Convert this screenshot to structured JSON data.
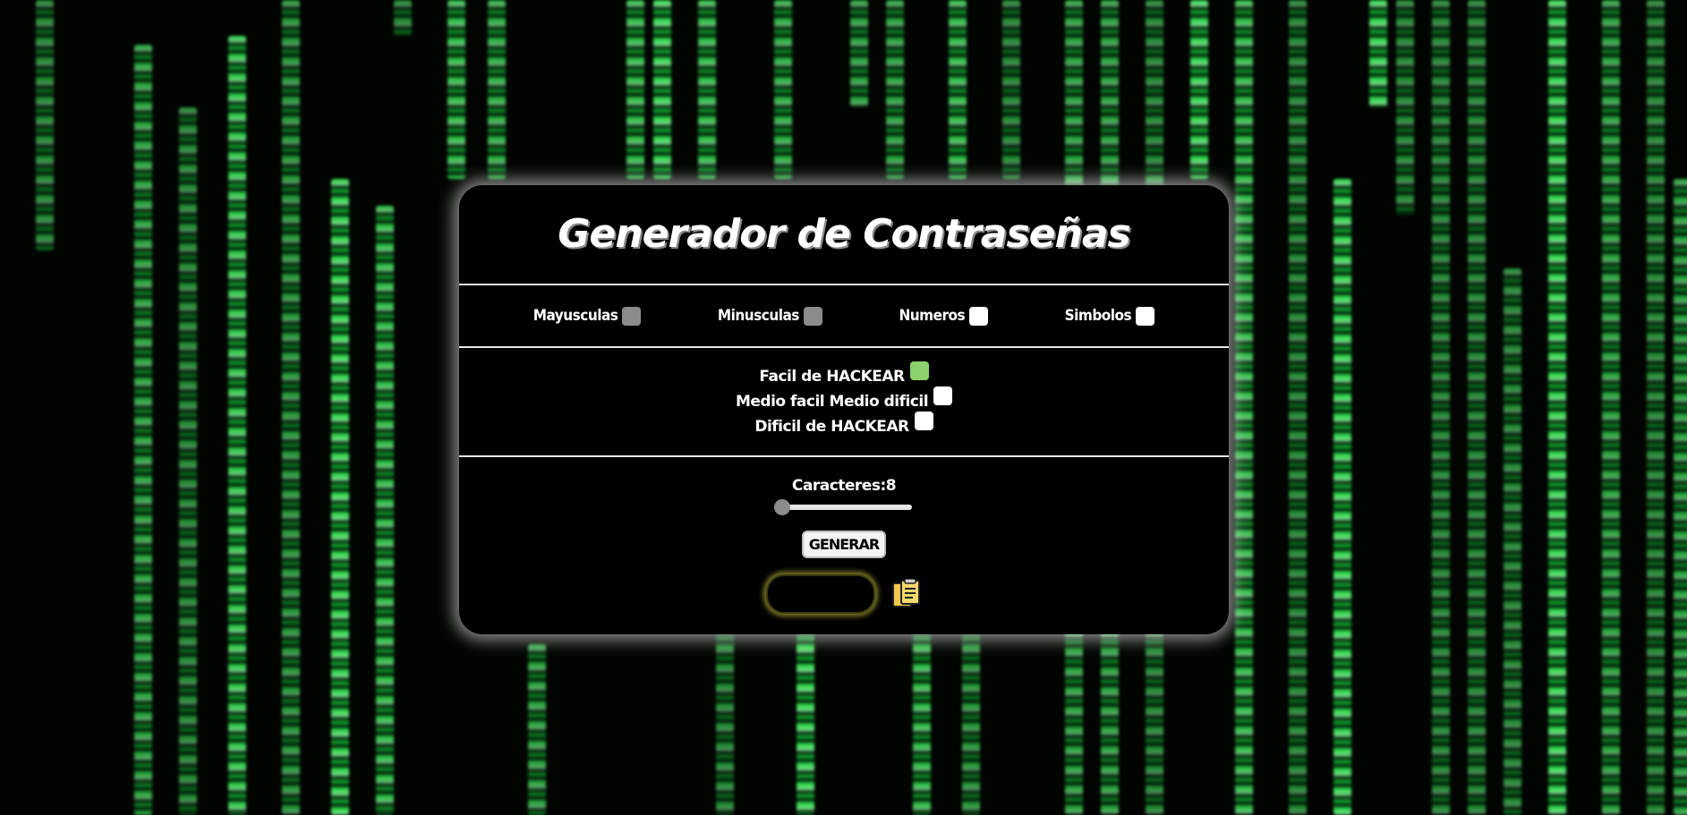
{
  "title": "Generador de Contraseñas",
  "options": [
    {
      "label": "Mayusculas",
      "state": "grey"
    },
    {
      "label": "Minusculas",
      "state": "grey"
    },
    {
      "label": "Numeros",
      "state": "white"
    },
    {
      "label": "Simbolos",
      "state": "white"
    }
  ],
  "difficulty": [
    {
      "label": "Facil de HACKEAR",
      "state": "green"
    },
    {
      "label": "Medio facil Medio dificil",
      "state": "white"
    },
    {
      "label": "Dificil de HACKEAR",
      "state": "white"
    }
  ],
  "length": {
    "label": "Caracteres:8",
    "value": 8
  },
  "generate_label": "GENERAR",
  "output_value": "",
  "icons": {
    "copy": "clipboard-copy-icon"
  },
  "colors": {
    "rain_green": "#39ff5a",
    "checkbox_green": "#8bd26d",
    "checkbox_grey": "#8b8b8b",
    "output_glow": "#e6dc46",
    "copy_icon": "#f2c94c"
  }
}
